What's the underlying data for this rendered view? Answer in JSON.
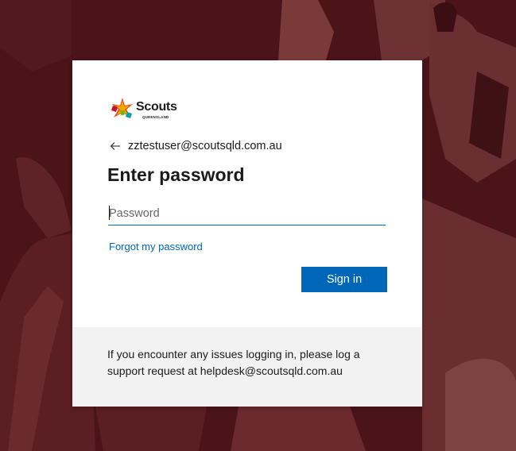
{
  "colors": {
    "background": "#4a1419",
    "accent": "#0067b8",
    "footer_bg": "#f2f2f2"
  },
  "logo": {
    "brand": "Scouts",
    "region": "QUEENSLAND"
  },
  "identity": {
    "icon": "arrow-left-icon",
    "email": "zztestuser@scoutsqld.com.au"
  },
  "title": "Enter password",
  "password": {
    "placeholder": "Password",
    "value": ""
  },
  "forgot_label": "Forgot my password",
  "signin_label": "Sign in",
  "footer": {
    "message": "If you encounter any issues logging in, please log a support request at helpdesk@scoutsqld.com.au"
  }
}
